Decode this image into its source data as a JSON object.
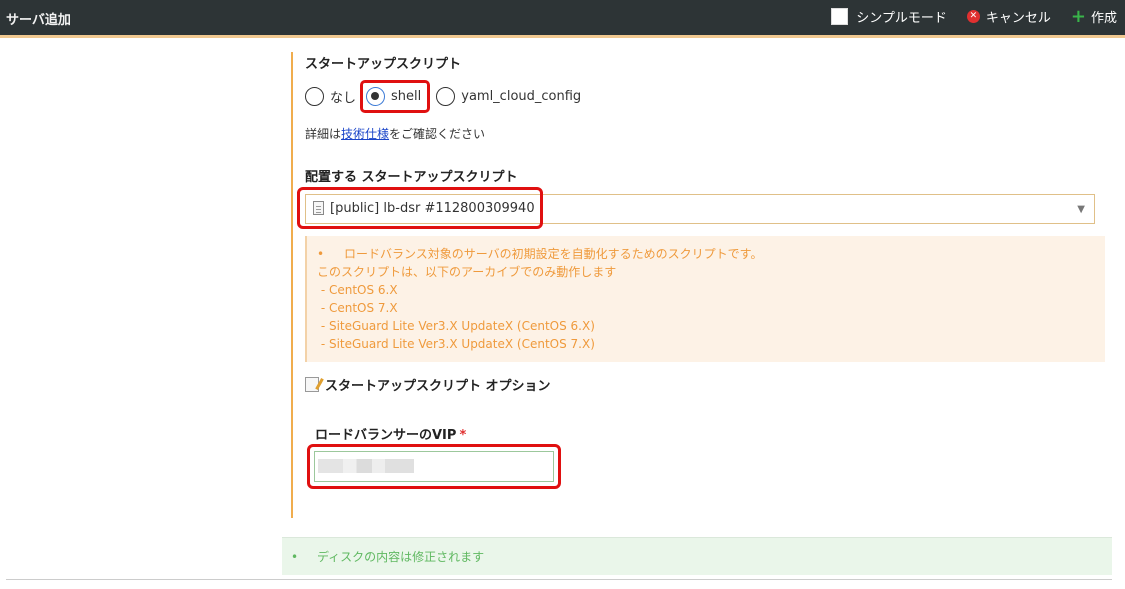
{
  "header": {
    "title": "サーバ追加",
    "simple_mode_label": "シンプルモード",
    "cancel_label": "キャンセル",
    "create_label": "作成"
  },
  "startup_script": {
    "section_label": "スタートアップスクリプト",
    "options": [
      {
        "label": "なし",
        "selected": false
      },
      {
        "label": "shell",
        "selected": true
      },
      {
        "label": "yaml_cloud_config",
        "selected": false
      }
    ],
    "detail_prefix": "詳細は",
    "detail_link": "技術仕様",
    "detail_suffix": "をご確認ください"
  },
  "deploy": {
    "label": "配置する スタートアップスクリプト",
    "selected_value": "[public] lb-dsr #112800309940"
  },
  "info": {
    "lines": [
      "ロードバランス対象のサーバの初期設定を自動化するためのスクリプトです。",
      "このスクリプトは、以下のアーカイブでのみ動作します",
      " - CentOS 6.X",
      " - CentOS 7.X",
      " - SiteGuard Lite Ver3.X UpdateX (CentOS 6.X)",
      " - SiteGuard Lite Ver3.X UpdateX (CentOS 7.X)"
    ],
    "bullet": "•"
  },
  "options": {
    "title": "スタートアップスクリプト オプション",
    "vip_label": "ロードバランサーのVIP",
    "required_mark": "*",
    "vip_value": ""
  },
  "status": {
    "bullet": "•",
    "message": "ディスクの内容は修正されます"
  }
}
